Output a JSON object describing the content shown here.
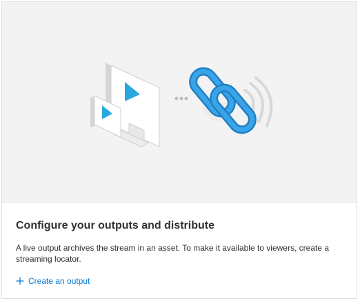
{
  "card": {
    "title": "Configure your outputs and distribute",
    "description": "A live output archives the stream in an asset. To make it available to viewers, create a streaming locator.",
    "action": {
      "icon": "plus-icon",
      "label": "Create an output"
    }
  },
  "illustration": {
    "icons": [
      "monitor-icon",
      "tablet-icon",
      "ellipsis-icon",
      "chain-link-icon",
      "broadcast-icon"
    ]
  },
  "colors": {
    "accent": "#0078d4",
    "play": "#29a8e0",
    "hero_background": "#f3f3f3",
    "text": "#323130"
  }
}
